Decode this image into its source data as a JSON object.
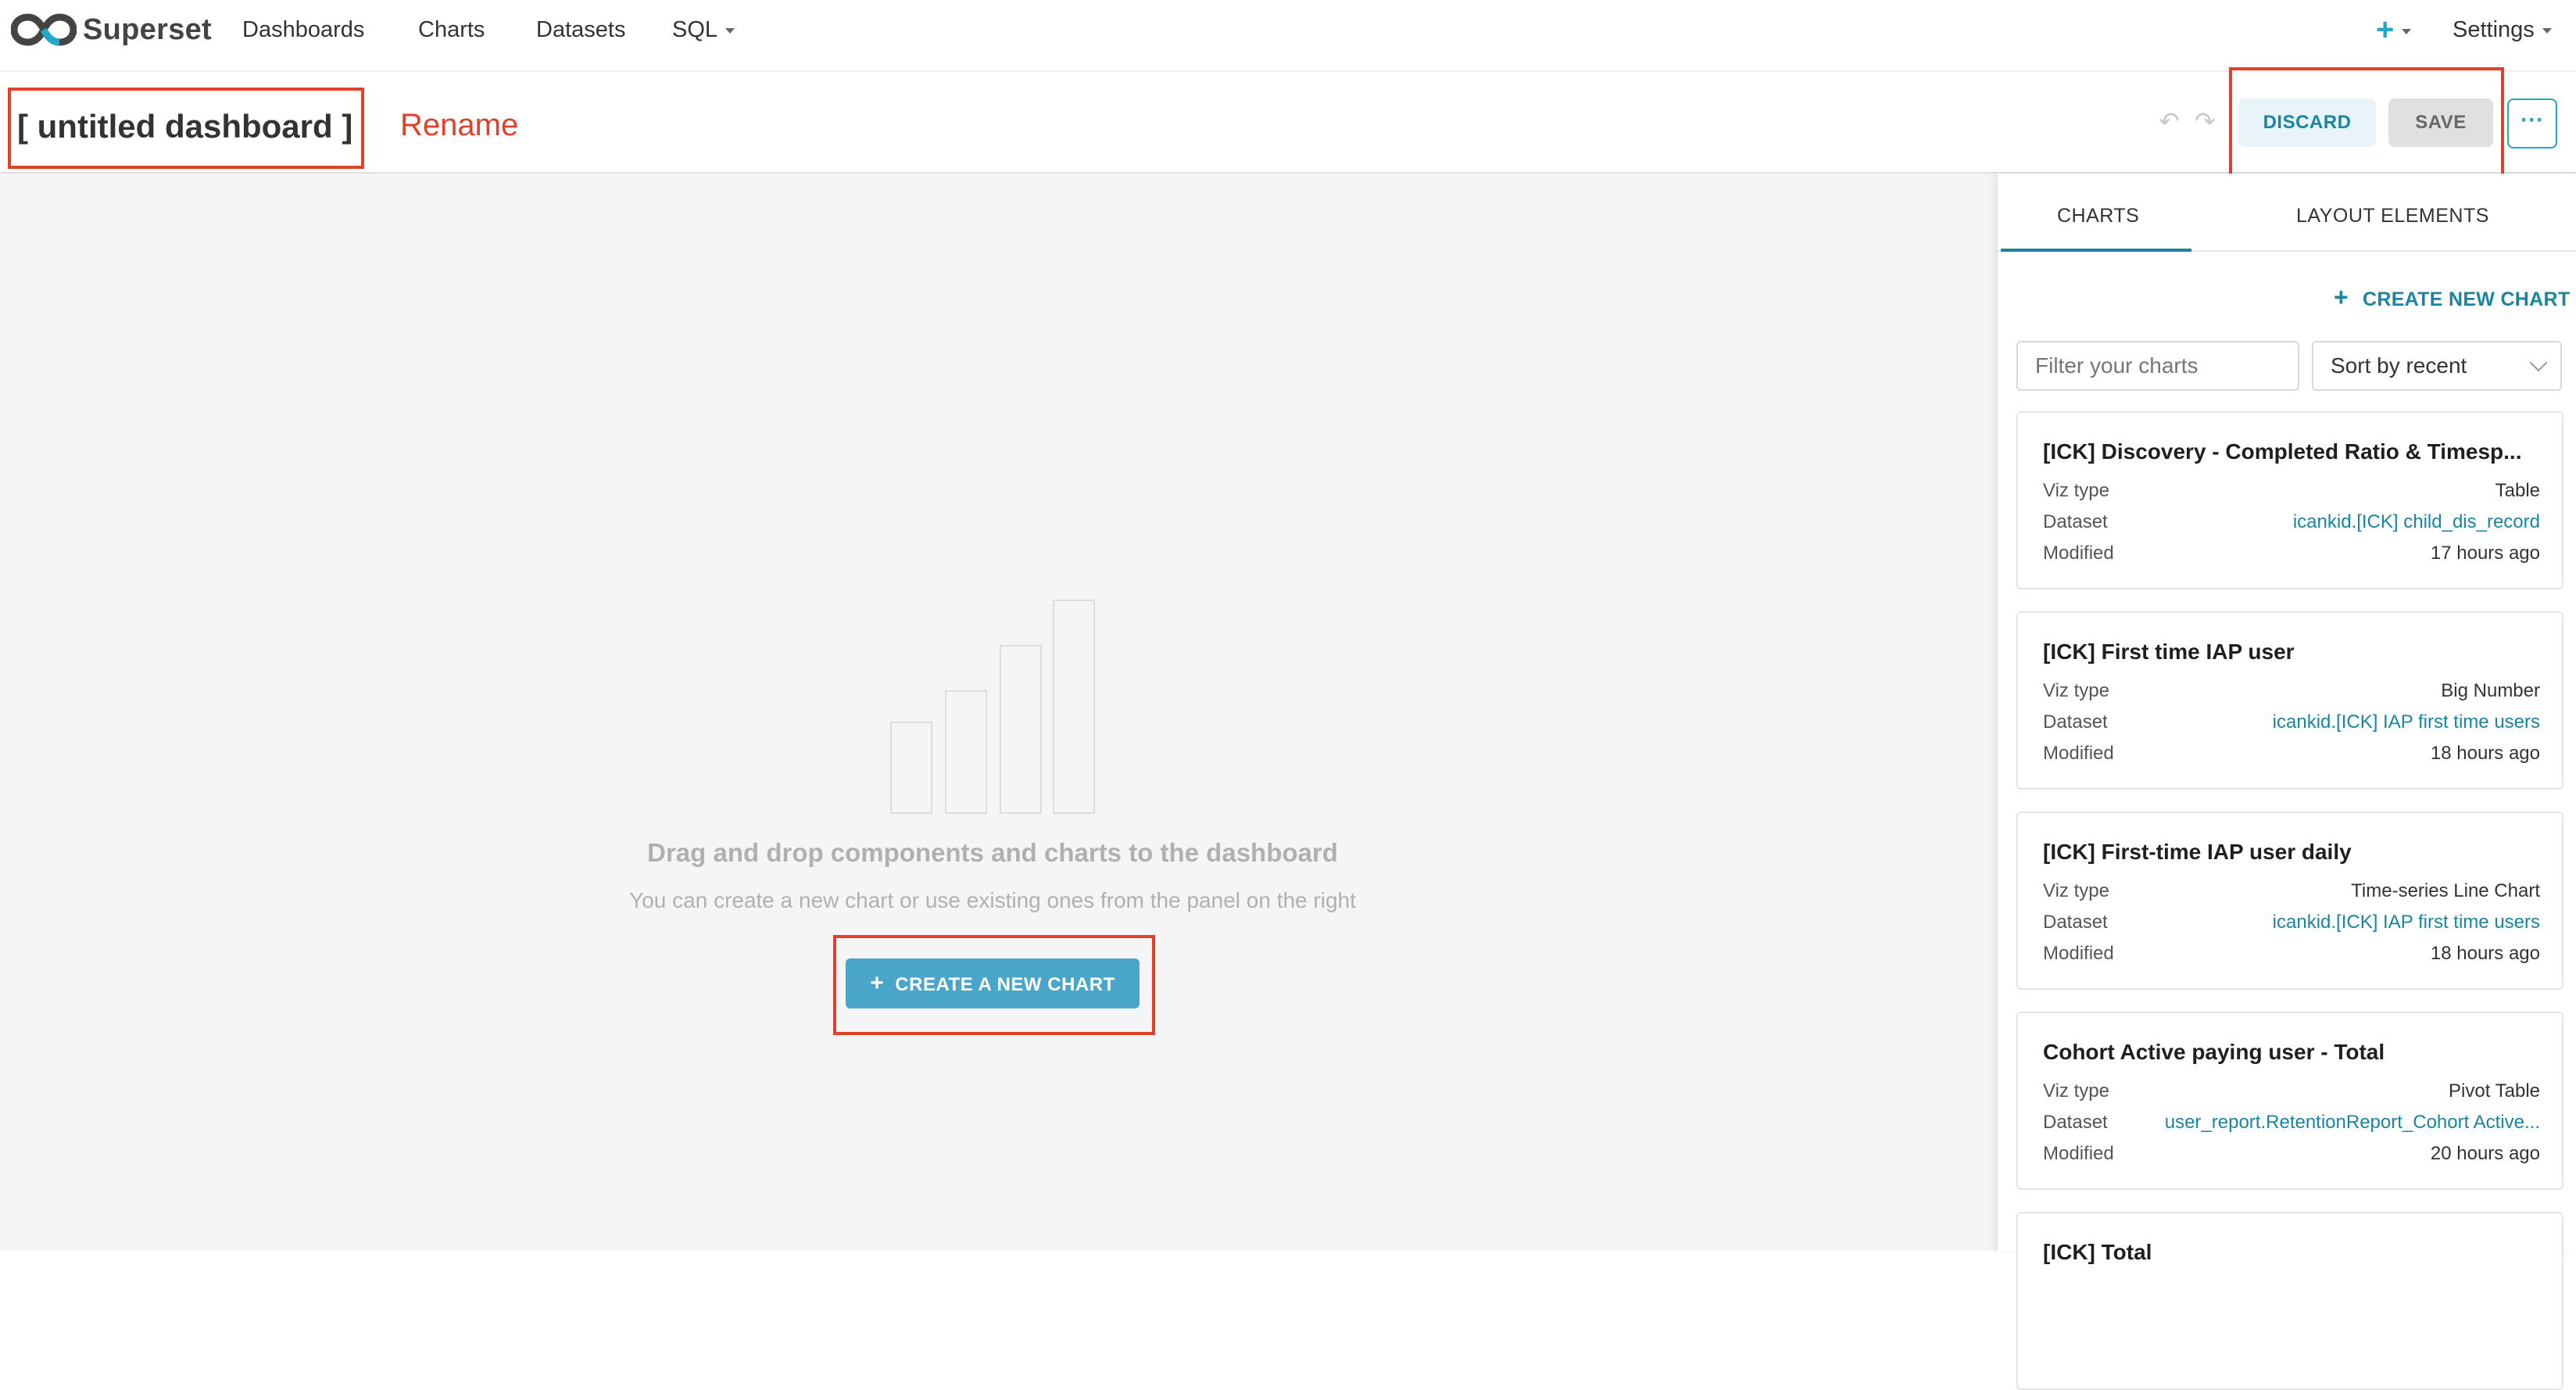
{
  "nav": {
    "brand": "Superset",
    "items": [
      "Dashboards",
      "Charts",
      "Datasets",
      "SQL"
    ],
    "plus_label": "+",
    "settings_label": "Settings"
  },
  "header": {
    "title": "[ untitled dashboard ]",
    "rename_annotation": "Rename",
    "undo_icon": "↶",
    "redo_icon": "↷",
    "discard_label": "DISCARD",
    "save_label": "SAVE",
    "more_label": "···"
  },
  "canvas": {
    "empty_title": "Drag and drop components and charts to the dashboard",
    "empty_subtitle": "You can create a new chart or use existing ones from the panel on the right",
    "create_button_label": "CREATE A NEW CHART",
    "create_button_plus": "+"
  },
  "panel": {
    "tabs": [
      "CHARTS",
      "LAYOUT ELEMENTS"
    ],
    "active_tab": "CHARTS",
    "create_new_chart_label": "CREATE NEW CHART",
    "create_new_chart_plus": "+",
    "filter_placeholder": "Filter your charts",
    "sort_value": "Sort by recent",
    "row_labels": {
      "viz": "Viz type",
      "dataset": "Dataset",
      "modified": "Modified"
    },
    "cards": [
      {
        "title": "[ICK] Discovery - Completed Ratio & Timesp...",
        "viz_type": "Table",
        "dataset": "icankid.[ICK] child_dis_record",
        "modified": "17 hours ago"
      },
      {
        "title": "[ICK] First time IAP user",
        "viz_type": "Big Number",
        "dataset": "icankid.[ICK] IAP first time users",
        "modified": "18 hours ago"
      },
      {
        "title": "[ICK] First-time IAP user daily",
        "viz_type": "Time-series Line Chart",
        "dataset": "icankid.[ICK] IAP first time users",
        "modified": "18 hours ago"
      },
      {
        "title": "Cohort Active paying user - Total",
        "viz_type": "Pivot Table",
        "dataset": "user_report.RetentionReport_Cohort Active...",
        "modified": "20 hours ago"
      },
      {
        "title": "[ICK] Total",
        "viz_type": "",
        "dataset": "",
        "modified": ""
      }
    ]
  },
  "colors": {
    "accent": "#20a7c9",
    "link": "#1a85a0",
    "annotation_red": "#e0412a",
    "create_button": "#4aa6c8"
  }
}
